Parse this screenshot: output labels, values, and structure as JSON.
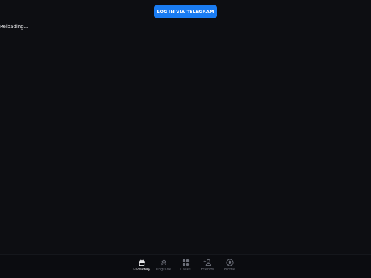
{
  "header": {
    "login_button_label": "LOG IN VIA TELEGRAM"
  },
  "main": {
    "status_text": "Reloading..."
  },
  "bottom_nav": {
    "active": "Giveaway",
    "items": [
      {
        "label": "Giveaway",
        "icon": "gift-icon"
      },
      {
        "label": "Upgrade",
        "icon": "upgrade-icon"
      },
      {
        "label": "Cases",
        "icon": "cases-icon"
      },
      {
        "label": "Friends",
        "icon": "add-friend-icon"
      },
      {
        "label": "Profile",
        "icon": "profile-icon"
      }
    ]
  },
  "colors": {
    "background": "#0d0e12",
    "accent": "#1a7cf2",
    "nav_active": "#e9e9ec",
    "nav_inactive": "#6d707a"
  }
}
